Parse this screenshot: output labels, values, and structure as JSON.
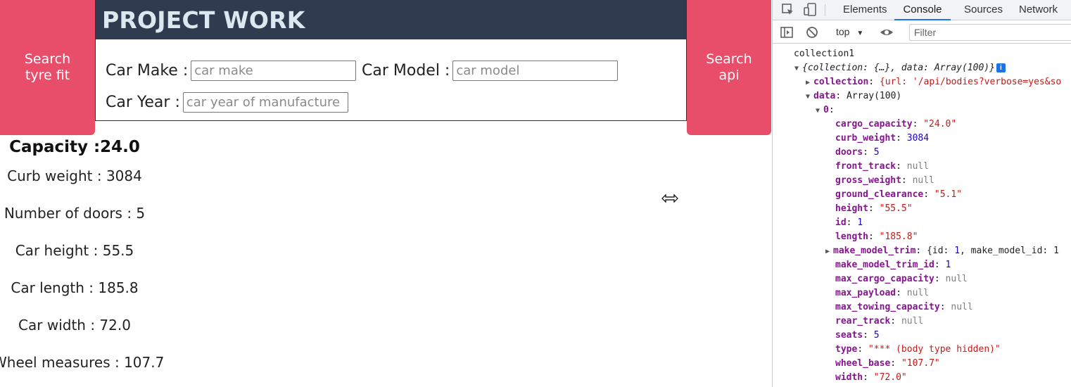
{
  "page": {
    "title": "PROJECT WORK",
    "left_button": "Search tyre fit",
    "right_button": "Search api",
    "form": {
      "make_label": "Car Make :",
      "make_placeholder": "car make",
      "model_label": "Car Model :",
      "model_placeholder": "car model",
      "year_label": "Car Year :",
      "year_placeholder": "car year of manufacture"
    },
    "results": {
      "capacity": "Capacity :24.0",
      "curb_weight": "Curb weight : 3084",
      "doors": "Number of doors : 5",
      "height": "Car height : 55.5",
      "length": "Car length : 185.8",
      "width": "Car width : 72.0",
      "wheel": "Wheel measures : 107.7"
    }
  },
  "devtools": {
    "tabs": [
      "Elements",
      "Console",
      "Sources",
      "Network"
    ],
    "active_tab": "Console",
    "context": "top",
    "filter_placeholder": "Filter",
    "console": {
      "log_label": "collection1",
      "root_summary": "{collection: {…}, data: Array(100)}",
      "collection_key": "collection",
      "collection_preview": "{url: '/api/bodies?verbose=yes&so",
      "data_key": "data",
      "data_preview": "Array(100)",
      "index_key": "0",
      "make_model_trim_key": "make_model_trim",
      "make_model_trim_preview_a": "{id: ",
      "make_model_trim_preview_id": "1",
      "make_model_trim_preview_b": ", make_model_id: 1",
      "fields": [
        {
          "key": "cargo_capacity",
          "value": "\"24.0\"",
          "kind": "string"
        },
        {
          "key": "curb_weight",
          "value": "3084",
          "kind": "number"
        },
        {
          "key": "doors",
          "value": "5",
          "kind": "number"
        },
        {
          "key": "front_track",
          "value": "null",
          "kind": "null"
        },
        {
          "key": "gross_weight",
          "value": "null",
          "kind": "null"
        },
        {
          "key": "ground_clearance",
          "value": "\"5.1\"",
          "kind": "string"
        },
        {
          "key": "height",
          "value": "\"55.5\"",
          "kind": "string"
        },
        {
          "key": "id",
          "value": "1",
          "kind": "number"
        },
        {
          "key": "length",
          "value": "\"185.8\"",
          "kind": "string"
        },
        {
          "key": "make_model_trim_id",
          "value": "1",
          "kind": "number"
        },
        {
          "key": "max_cargo_capacity",
          "value": "null",
          "kind": "null"
        },
        {
          "key": "max_payload",
          "value": "null",
          "kind": "null"
        },
        {
          "key": "max_towing_capacity",
          "value": "null",
          "kind": "null"
        },
        {
          "key": "rear_track",
          "value": "null",
          "kind": "null"
        },
        {
          "key": "seats",
          "value": "5",
          "kind": "number"
        },
        {
          "key": "type",
          "value": "\"*** (body type hidden)\"",
          "kind": "string"
        },
        {
          "key": "wheel_base",
          "value": "\"107.7\"",
          "kind": "string"
        },
        {
          "key": "width",
          "value": "\"72.0\"",
          "kind": "string"
        }
      ]
    }
  }
}
